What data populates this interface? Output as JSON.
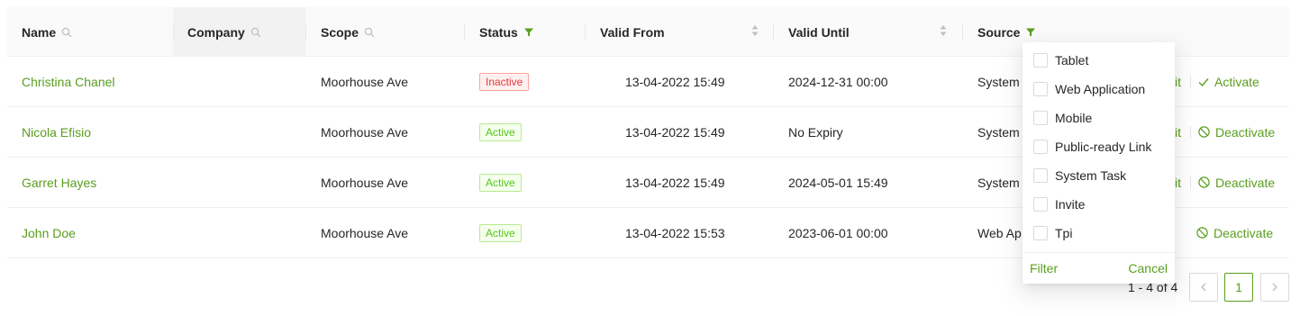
{
  "columns": {
    "name": "Name",
    "company": "Company",
    "scope": "Scope",
    "status": "Status",
    "valid_from": "Valid From",
    "valid_until": "Valid Until",
    "source": "Source"
  },
  "rows": [
    {
      "name": "Christina Chanel",
      "scope": "Moorhouse Ave",
      "status": "Inactive",
      "valid_from": "13-04-2022 15:49",
      "valid_until": "2024-12-31 00:00",
      "source": "System",
      "edit": "it",
      "action": "Activate"
    },
    {
      "name": "Nicola Efisio",
      "scope": "Moorhouse Ave",
      "status": "Active",
      "valid_from": "13-04-2022 15:49",
      "valid_until": "No Expiry",
      "source": "System",
      "edit": "it",
      "action": "Deactivate"
    },
    {
      "name": "Garret Hayes",
      "scope": "Moorhouse Ave",
      "status": "Active",
      "valid_from": "13-04-2022 15:49",
      "valid_until": "2024-05-01 15:49",
      "source": "System",
      "edit": "it",
      "action": "Deactivate"
    },
    {
      "name": "John Doe",
      "scope": "Moorhouse Ave",
      "status": "Active",
      "valid_from": "13-04-2022 15:53",
      "valid_until": "2023-06-01 00:00",
      "source": "Web Ap",
      "edit": "",
      "action": "Deactivate"
    }
  ],
  "source_filter": {
    "options": [
      "Tablet",
      "Web Application",
      "Mobile",
      "Public-ready Link",
      "System Task",
      "Invite",
      "Tpi"
    ],
    "filter_label": "Filter",
    "cancel_label": "Cancel"
  },
  "pagination": {
    "total_text": "1 - 4 of 4",
    "current_page": "1"
  },
  "colors": {
    "accent": "#5a9e1e",
    "inactive": "#e5383b",
    "active": "#52c41a"
  },
  "icons": [
    "search-icon",
    "filter-icon",
    "sort-icon",
    "check-icon",
    "stop-icon",
    "chevron-left-icon",
    "chevron-right-icon"
  ]
}
